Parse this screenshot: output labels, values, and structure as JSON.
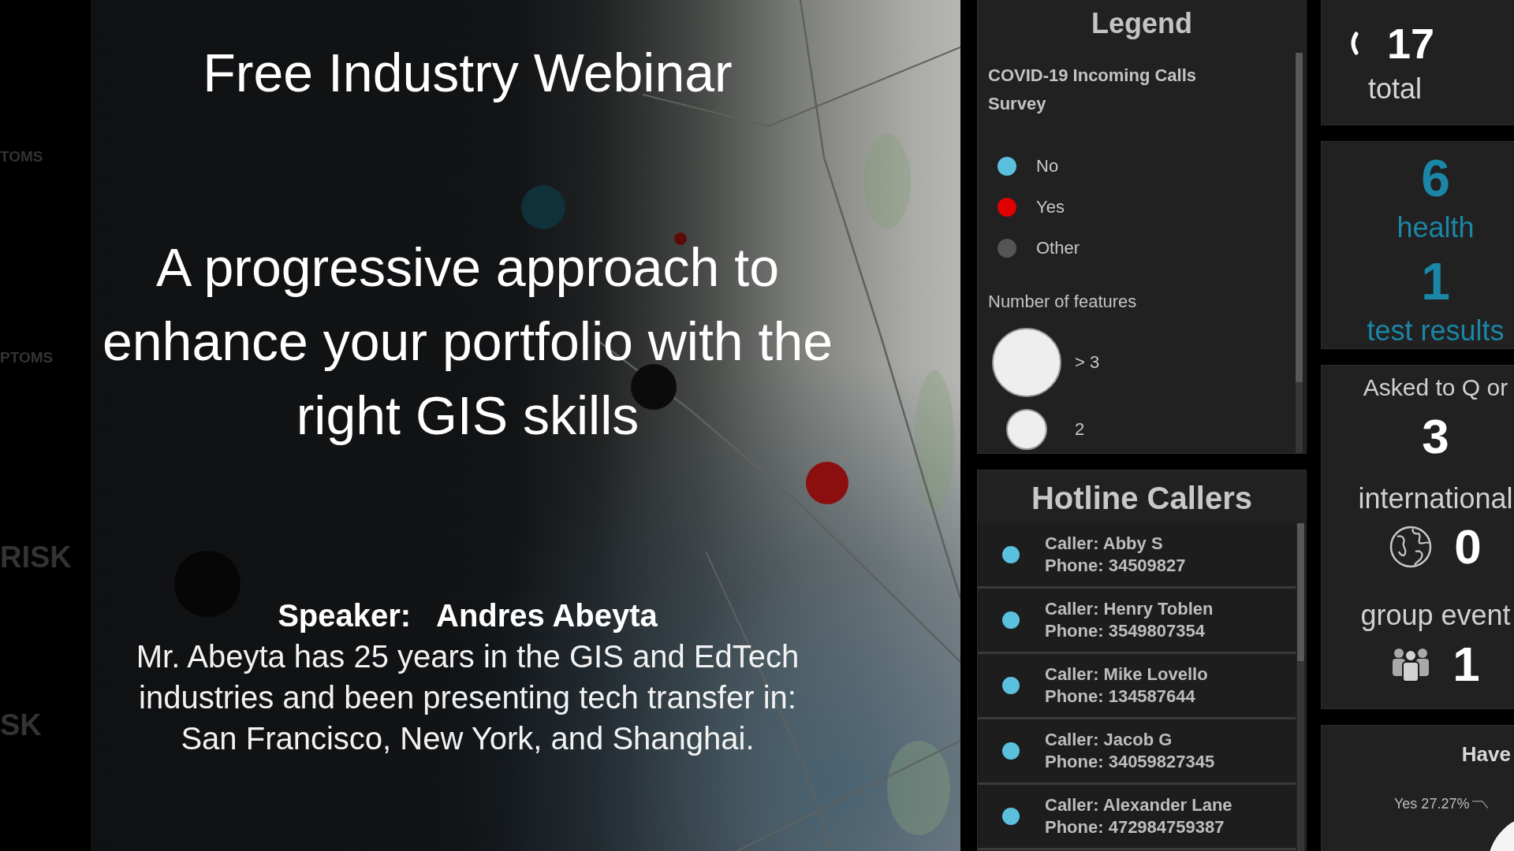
{
  "promo": {
    "side_labels": [
      "TOMS",
      "PTOMS",
      "RISK",
      "SK"
    ],
    "title": "Free Industry Webinar",
    "headline_lines": [
      "A progressive approach to",
      "enhance your portfolio with the",
      "right GIS skills"
    ],
    "speaker": "Speaker:   Andres Abeyta",
    "bio_lines": [
      "Mr. Abeyta has 25 years in the GIS and EdTech",
      "industries and been presenting tech transfer in:",
      "San Francisco, New York, and Shanghai."
    ]
  },
  "legend": {
    "title": "Legend",
    "layer": "COVID-19 Incoming Calls Survey",
    "categories": [
      {
        "label": "No",
        "color": "#5bc0de"
      },
      {
        "label": "Yes",
        "color": "#e00000"
      },
      {
        "label": "Other",
        "color": "#555555"
      }
    ],
    "size_title": "Number of features",
    "sizes": [
      {
        "label": "> 3",
        "kind": "large"
      },
      {
        "label": "2",
        "kind": "small"
      }
    ]
  },
  "hotline": {
    "title": "Hotline Callers",
    "callers": [
      {
        "caller": "Caller: Abby S",
        "phone": "Phone: 34509827",
        "color": "#5bc0de"
      },
      {
        "caller": "Caller: Henry Toblen",
        "phone": "Phone: 3549807354",
        "color": "#5bc0de"
      },
      {
        "caller": "Caller: Mike Lovello",
        "phone": "Phone: 134587644",
        "color": "#5bc0de"
      },
      {
        "caller": "Caller: Jacob G",
        "phone": "Phone: 34059827345",
        "color": "#5bc0de"
      },
      {
        "caller": "Caller: Alexander Lane",
        "phone": "Phone: 472984759387",
        "color": "#5bc0de"
      }
    ]
  },
  "indicators": [
    {
      "kind": "total",
      "value": "17",
      "label": "total"
    },
    {
      "kind": "pair",
      "items": [
        {
          "value": "6",
          "label": "health"
        },
        {
          "value": "1",
          "label": "test results"
        }
      ]
    },
    {
      "kind": "breakdown",
      "title": "Asked to Q or",
      "value": "3",
      "rows": [
        {
          "label": "international",
          "value": "0"
        },
        {
          "label": "group event",
          "value": "1"
        }
      ]
    },
    {
      "kind": "chart",
      "title": "Have",
      "slice_label": "Yes 27.27%"
    }
  ]
}
